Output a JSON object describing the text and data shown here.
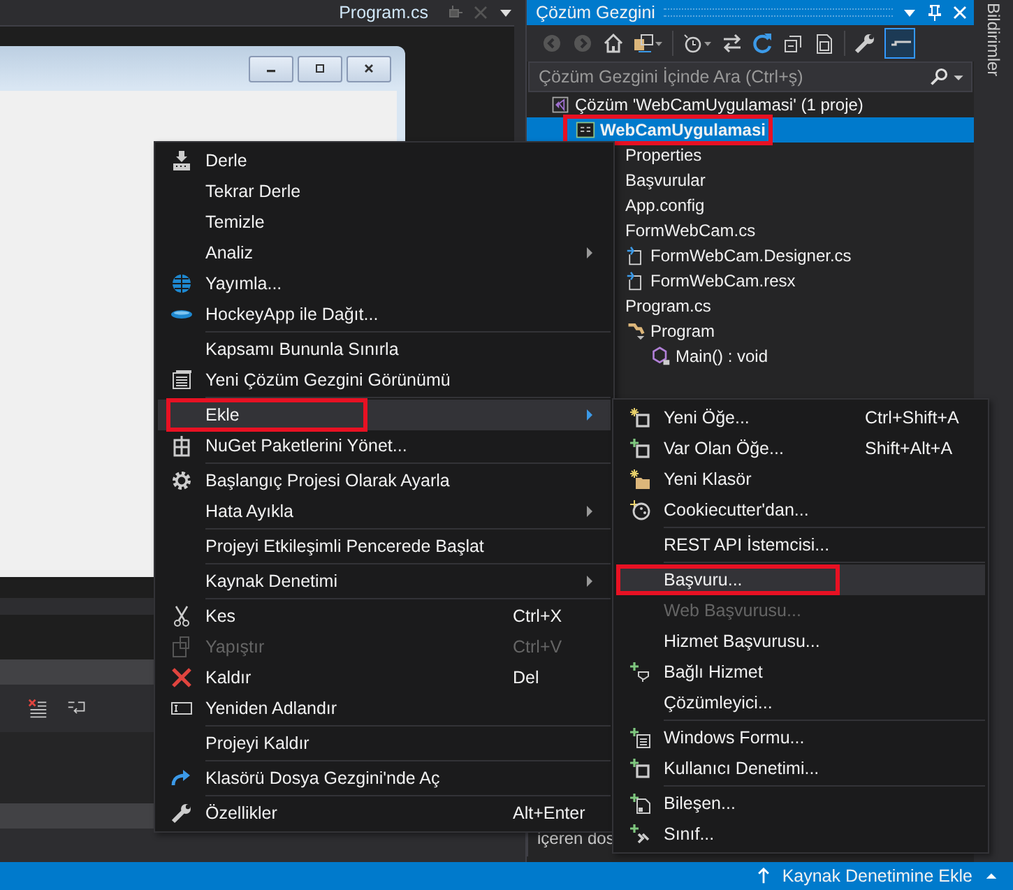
{
  "editor_tab": {
    "title": "Program.cs"
  },
  "solution_explorer": {
    "title": "Çözüm Gezgini",
    "preview_toggle": {
      "on": true
    },
    "search": {
      "placeholder": "Çözüm Gezgini İçinde Ara (Ctrl+ş)"
    },
    "tree": [
      {
        "label": "Çözüm 'WebCamUygulamasi' (1 proje)",
        "selected": false,
        "highlighted": false,
        "children": [
          {
            "label": "WebCamUygulamasi",
            "selected": true,
            "highlighted": true,
            "children": [
              {
                "label": "Properties",
                "selected": false,
                "highlighted": false
              },
              {
                "label": "Başvurular",
                "selected": false,
                "highlighted": false
              },
              {
                "label": "App.config",
                "selected": false,
                "highlighted": false
              },
              {
                "label": "FormWebCam.cs",
                "selected": false,
                "highlighted": false,
                "children": [
                  {
                    "label": "FormWebCam.Designer.cs",
                    "selected": false,
                    "highlighted": false
                  },
                  {
                    "label": "FormWebCam.resx",
                    "selected": false,
                    "highlighted": false
                  }
                ]
              },
              {
                "label": "Program.cs",
                "selected": false,
                "highlighted": false,
                "children": [
                  {
                    "label": "Program",
                    "selected": false,
                    "highlighted": false,
                    "children": [
                      {
                        "label": "Main() : void",
                        "selected": false,
                        "highlighted": false
                      }
                    ]
                  }
                ]
              }
            ]
          }
        ]
      }
    ],
    "lower_pane": {
      "text": "içeren dos"
    }
  },
  "side_strip": {
    "label": "Bildirimler"
  },
  "context_menu": [
    {
      "kind": "item",
      "label": "Derle",
      "selected": false,
      "disabled": false,
      "highlighted": false,
      "submenu": false
    },
    {
      "kind": "item",
      "label": "Tekrar Derle",
      "selected": false,
      "disabled": false,
      "highlighted": false,
      "submenu": false
    },
    {
      "kind": "item",
      "label": "Temizle",
      "selected": false,
      "disabled": false,
      "highlighted": false,
      "submenu": false
    },
    {
      "kind": "item",
      "label": "Analiz",
      "selected": false,
      "disabled": false,
      "highlighted": false,
      "submenu": true
    },
    {
      "kind": "item",
      "label": "Yayımla...",
      "selected": false,
      "disabled": false,
      "highlighted": false,
      "submenu": false
    },
    {
      "kind": "item",
      "label": "HockeyApp ile Dağıt...",
      "selected": false,
      "disabled": false,
      "highlighted": false,
      "submenu": false
    },
    {
      "kind": "separator"
    },
    {
      "kind": "item",
      "label": "Kapsamı Bununla Sınırla",
      "selected": false,
      "disabled": false,
      "highlighted": false,
      "submenu": false
    },
    {
      "kind": "item",
      "label": "Yeni Çözüm Gezgini Görünümü",
      "selected": false,
      "disabled": false,
      "highlighted": false,
      "submenu": false
    },
    {
      "kind": "separator"
    },
    {
      "kind": "item",
      "label": "Ekle",
      "selected": true,
      "disabled": false,
      "highlighted": true,
      "submenu": true
    },
    {
      "kind": "item",
      "label": "NuGet Paketlerini Yönet...",
      "selected": false,
      "disabled": false,
      "highlighted": false,
      "submenu": false
    },
    {
      "kind": "separator"
    },
    {
      "kind": "item",
      "label": "Başlangıç Projesi Olarak Ayarla",
      "selected": false,
      "disabled": false,
      "highlighted": false,
      "submenu": false
    },
    {
      "kind": "item",
      "label": "Hata Ayıkla",
      "selected": false,
      "disabled": false,
      "highlighted": false,
      "submenu": true
    },
    {
      "kind": "separator"
    },
    {
      "kind": "item",
      "label": "Projeyi Etkileşimli Pencerede Başlat",
      "selected": false,
      "disabled": false,
      "highlighted": false,
      "submenu": false
    },
    {
      "kind": "separator"
    },
    {
      "kind": "item",
      "label": "Kaynak Denetimi",
      "selected": false,
      "disabled": false,
      "highlighted": false,
      "submenu": true
    },
    {
      "kind": "separator"
    },
    {
      "kind": "item",
      "label": "Kes",
      "shortcut": "Ctrl+X",
      "selected": false,
      "disabled": false,
      "highlighted": false,
      "submenu": false
    },
    {
      "kind": "item",
      "label": "Yapıştır",
      "shortcut": "Ctrl+V",
      "selected": false,
      "disabled": true,
      "highlighted": false,
      "submenu": false
    },
    {
      "kind": "item",
      "label": "Kaldır",
      "shortcut": "Del",
      "selected": false,
      "disabled": false,
      "highlighted": false,
      "submenu": false
    },
    {
      "kind": "item",
      "label": "Yeniden Adlandır",
      "selected": false,
      "disabled": false,
      "highlighted": false,
      "submenu": false
    },
    {
      "kind": "separator"
    },
    {
      "kind": "item",
      "label": "Projeyi Kaldır",
      "selected": false,
      "disabled": false,
      "highlighted": false,
      "submenu": false
    },
    {
      "kind": "separator"
    },
    {
      "kind": "item",
      "label": "Klasörü Dosya Gezgini'nde Aç",
      "selected": false,
      "disabled": false,
      "highlighted": false,
      "submenu": false
    },
    {
      "kind": "separator"
    },
    {
      "kind": "item",
      "label": "Özellikler",
      "shortcut": "Alt+Enter",
      "selected": false,
      "disabled": false,
      "highlighted": false,
      "submenu": false
    }
  ],
  "submenu": [
    {
      "kind": "item",
      "label": "Yeni Öğe...",
      "shortcut": "Ctrl+Shift+A",
      "selected": false,
      "disabled": false,
      "highlighted": false
    },
    {
      "kind": "item",
      "label": "Var Olan Öğe...",
      "shortcut": "Shift+Alt+A",
      "selected": false,
      "disabled": false,
      "highlighted": false
    },
    {
      "kind": "item",
      "label": "Yeni Klasör",
      "selected": false,
      "disabled": false,
      "highlighted": false
    },
    {
      "kind": "item",
      "label": "Cookiecutter'dan...",
      "selected": false,
      "disabled": false,
      "highlighted": false
    },
    {
      "kind": "separator"
    },
    {
      "kind": "item",
      "label": "REST API İstemcisi...",
      "selected": false,
      "disabled": false,
      "highlighted": false
    },
    {
      "kind": "separator"
    },
    {
      "kind": "item",
      "label": "Başvuru...",
      "selected": true,
      "disabled": false,
      "highlighted": true
    },
    {
      "kind": "item",
      "label": "Web Başvurusu...",
      "selected": false,
      "disabled": true,
      "highlighted": false
    },
    {
      "kind": "item",
      "label": "Hizmet Başvurusu...",
      "selected": false,
      "disabled": false,
      "highlighted": false
    },
    {
      "kind": "item",
      "label": "Bağlı Hizmet",
      "selected": false,
      "disabled": false,
      "highlighted": false
    },
    {
      "kind": "item",
      "label": "Çözümleyici...",
      "selected": false,
      "disabled": false,
      "highlighted": false
    },
    {
      "kind": "separator"
    },
    {
      "kind": "item",
      "label": "Windows Formu...",
      "selected": false,
      "disabled": false,
      "highlighted": false
    },
    {
      "kind": "item",
      "label": "Kullanıcı Denetimi...",
      "selected": false,
      "disabled": false,
      "highlighted": false
    },
    {
      "kind": "separator"
    },
    {
      "kind": "item",
      "label": "Bileşen...",
      "selected": false,
      "disabled": false,
      "highlighted": false
    },
    {
      "kind": "item",
      "label": "Sınıf...",
      "selected": false,
      "disabled": false,
      "highlighted": false
    }
  ],
  "status_bar": {
    "action": "Kaynak Denetimine Ekle"
  }
}
